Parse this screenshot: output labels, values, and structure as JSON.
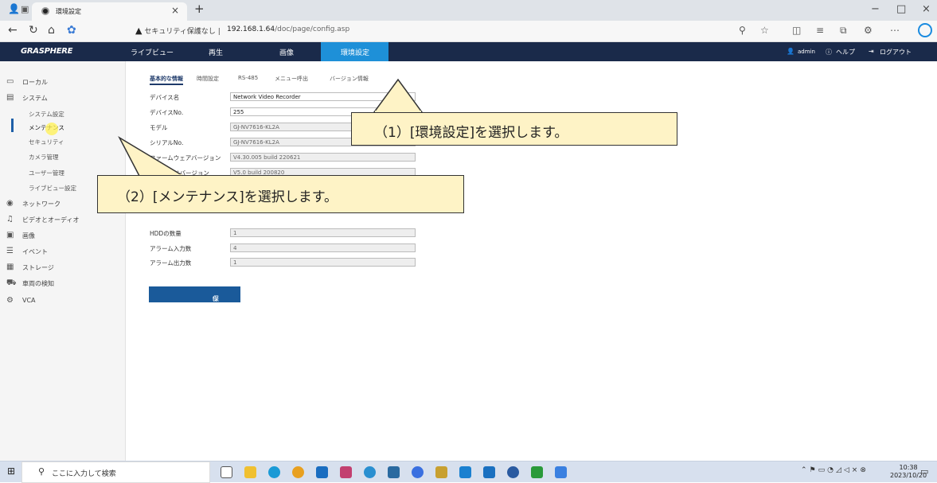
{
  "browser": {
    "tab_title": "環境設定",
    "tab_close": "×",
    "new_tab": "+",
    "security_warning": "セキュリティ保護なし",
    "url_separator": "|",
    "url_host": "192.168.1.64",
    "url_path": "/doc/page/config.asp",
    "window_buttons": [
      "−",
      "□",
      "×"
    ]
  },
  "app": {
    "logo": "GRASPHERE",
    "nav": [
      "ライブビュー",
      "再生",
      "画像",
      "環境設定"
    ],
    "user": "admin",
    "help": "ヘルプ",
    "logout": "ログアウト"
  },
  "sidebar": {
    "items": [
      {
        "label": "ローカル",
        "icon": "monitor-icon"
      },
      {
        "label": "システム",
        "icon": "system-icon"
      },
      {
        "label": "ネットワーク",
        "icon": "network-icon"
      },
      {
        "label": "ビデオとオーディオ",
        "icon": "video-audio-icon"
      },
      {
        "label": "画像",
        "icon": "image-icon"
      },
      {
        "label": "イベント",
        "icon": "event-icon"
      },
      {
        "label": "ストレージ",
        "icon": "storage-icon"
      },
      {
        "label": "車両の検知",
        "icon": "vehicle-icon"
      },
      {
        "label": "VCA",
        "icon": "vca-icon"
      }
    ],
    "system_sub": [
      "システム設定",
      "メンテナンス",
      "セキュリティ",
      "カメラ管理",
      "ユーザー管理",
      "ライブビュー設定"
    ]
  },
  "subtabs": [
    "基本的な情報",
    "時間設定",
    "RS-485",
    "メニュー呼出",
    "バージョン情報"
  ],
  "form": {
    "fields": [
      {
        "label": "デバイス名",
        "value": "Network Video Recorder"
      },
      {
        "label": "デバイスNo.",
        "value": "255"
      },
      {
        "label": "モデル",
        "value": "GJ-NV7616-KL2A"
      },
      {
        "label": "シリアルNo.",
        "value": "GJ-NV7616-KL2A"
      },
      {
        "label": "ファームウェアバージョン",
        "value": "V4.30.005 build 220621"
      },
      {
        "label": "エンコードバージョン",
        "value": "V5.0 build 200820"
      },
      {
        "label": "HDDの数量",
        "value": "1"
      },
      {
        "label": "アラーム入力数",
        "value": "4"
      },
      {
        "label": "アラーム出力数",
        "value": "1"
      }
    ],
    "save_label": "保存"
  },
  "callouts": {
    "step1": "（1）[環境設定]を選択します。",
    "step2": "（2）[メンテナンス]を選択します。"
  },
  "taskbar": {
    "search_placeholder": "ここに入力して検索",
    "time": "10:38",
    "date": "2023/10/20"
  },
  "colors": {
    "header_bg": "#1a2a4a",
    "active_nav": "#1e90d8",
    "callout_bg": "#fef3c6"
  }
}
